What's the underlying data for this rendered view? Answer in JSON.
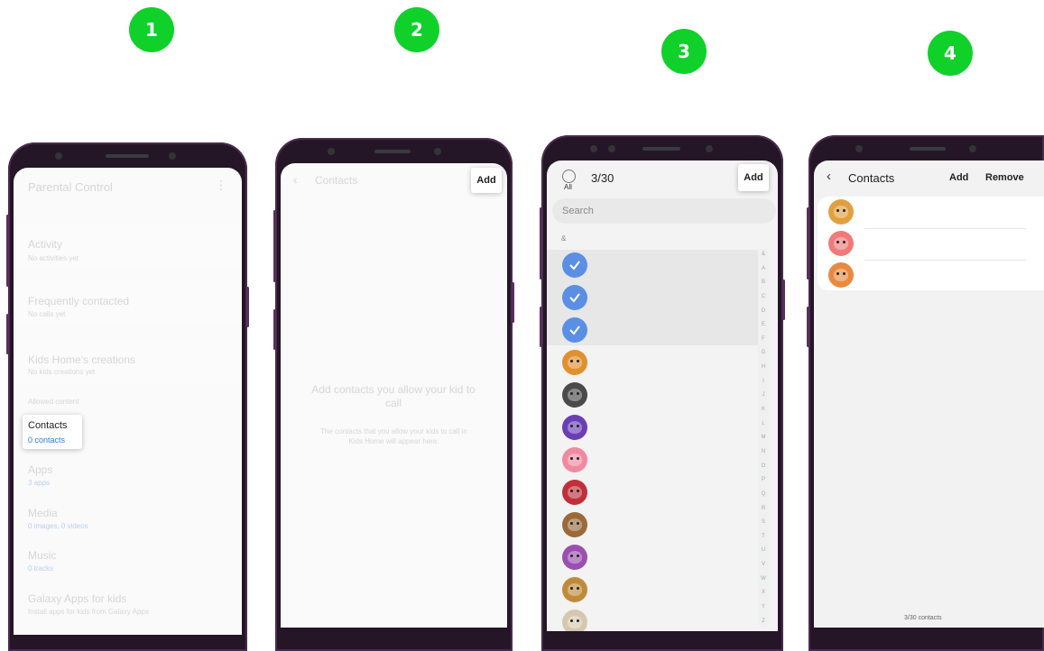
{
  "steps": [
    "1",
    "2",
    "3",
    "4"
  ],
  "screen1": {
    "title": "Parental Control",
    "menu_icon": "more-vert-icon",
    "items": [
      {
        "label": "Activity",
        "sub": "No activities yet"
      },
      {
        "label": "Frequently contacted",
        "sub": "No calls yet"
      },
      {
        "label": "Kids Home's creations",
        "sub": "No kids creations yet"
      }
    ],
    "section_header": "Allowed content",
    "contacts": {
      "label": "Contacts",
      "sub": "0 contacts"
    },
    "content_items": [
      {
        "label": "Apps",
        "sub": "3 apps"
      },
      {
        "label": "Media",
        "sub": "0 images, 0 videos"
      },
      {
        "label": "Music",
        "sub": "0 tracks"
      },
      {
        "label": "Galaxy Apps for kids",
        "sub": "Install apps for kids from Galaxy Apps"
      }
    ]
  },
  "screen2": {
    "title": "Contacts",
    "add_label": "Add",
    "empty_title": "Add contacts you allow your kid to call",
    "empty_desc": "The contacts that you allow your kids to call in Kids Home will appear here."
  },
  "screen3": {
    "all_label": "All",
    "count": "3/30",
    "add_label": "Add",
    "search_placeholder": "Search",
    "section": "&",
    "index_letters": [
      "&",
      "A",
      "B",
      "C",
      "D",
      "E",
      "F",
      "G",
      "H",
      "I",
      "J",
      "K",
      "L",
      "M",
      "N",
      "O",
      "P",
      "Q",
      "R",
      "S",
      "T",
      "U",
      "V",
      "W",
      "X",
      "Y",
      "Z"
    ],
    "avatar_colors": [
      "#e0902f",
      "#4a4a4a",
      "#6a3fb5",
      "#f08aa0",
      "#c0303a",
      "#9a6a3a",
      "#9b4fb0",
      "#c08a3a",
      "#d6c8b0"
    ]
  },
  "screen4": {
    "title": "Contacts",
    "add_label": "Add",
    "remove_label": "Remove",
    "footer": "3/30 contacts",
    "avatar_colors": [
      "#e0a040",
      "#f07a7a",
      "#e88a40"
    ]
  }
}
